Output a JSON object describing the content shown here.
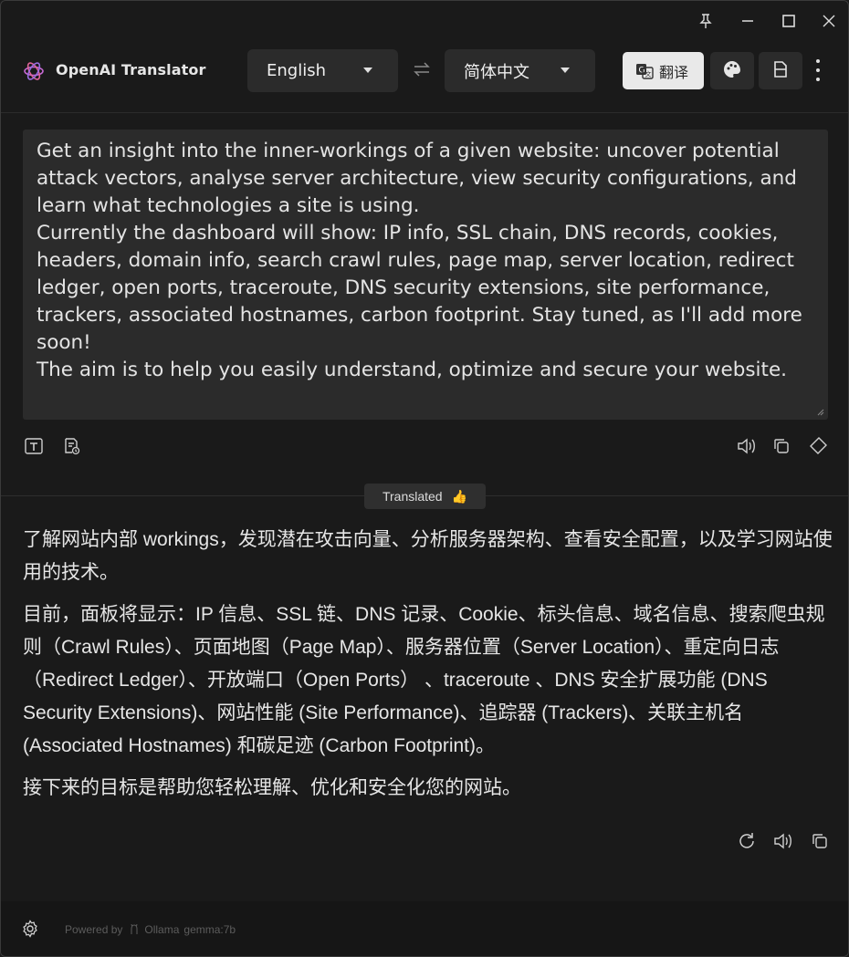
{
  "window_controls": {
    "pin_icon": "pin-icon",
    "minimize_icon": "minimize-icon",
    "maximize_icon": "maximize-icon",
    "close_icon": "close-icon"
  },
  "header": {
    "app_title": "OpenAI Translator",
    "source_language": "English",
    "target_language": "简体中文",
    "translate_label": "翻译"
  },
  "source_text": {
    "paragraphs": [
      "Get an insight into the inner-workings of a given website: uncover potential attack vectors, analyse server architecture, view security configurations, and learn what technologies a site is using.",
      "Currently the dashboard will show: IP info, SSL chain, DNS records, cookies, headers, domain info, search crawl rules, page map, server location, redirect ledger, open ports, traceroute, DNS security extensions, site performance, trackers, associated hostnames, carbon footprint. Stay tuned, as I'll add more soon!",
      "The aim is to help you easily understand, optimize and secure your website."
    ]
  },
  "status_badge": {
    "label": "Translated",
    "emoji": "👍"
  },
  "translation": {
    "paragraphs": [
      "了解网站内部 workings，发现潜在攻击向量、分析服务器架构、查看安全配置，以及学习网站使用的技术。",
      "目前，面板将显示：IP 信息、SSL 链、DNS 记录、Cookie、标头信息、域名信息、搜索爬虫规则（Crawl Rules）、页面地图（Page Map）、服务器位置（Server Location）、重定向日志（Redirect Ledger）、开放端口（Open Ports） 、traceroute 、DNS 安全扩展功能 (DNS Security Extensions)、网站性能 (Site Performance)、追踪器 (Trackers)、关联主机名 (Associated Hostnames) 和碳足迹 (Carbon Footprint)。",
      "接下来的目标是帮助您轻松理解、优化和安全化您的网站。"
    ]
  },
  "footer": {
    "powered_by": "Powered by",
    "provider": "Ollama",
    "model": "gemma:7b"
  },
  "colors": {
    "background": "#1a1a1a",
    "panel": "#2b2b2b",
    "translate_button": "#e9e9e9"
  }
}
